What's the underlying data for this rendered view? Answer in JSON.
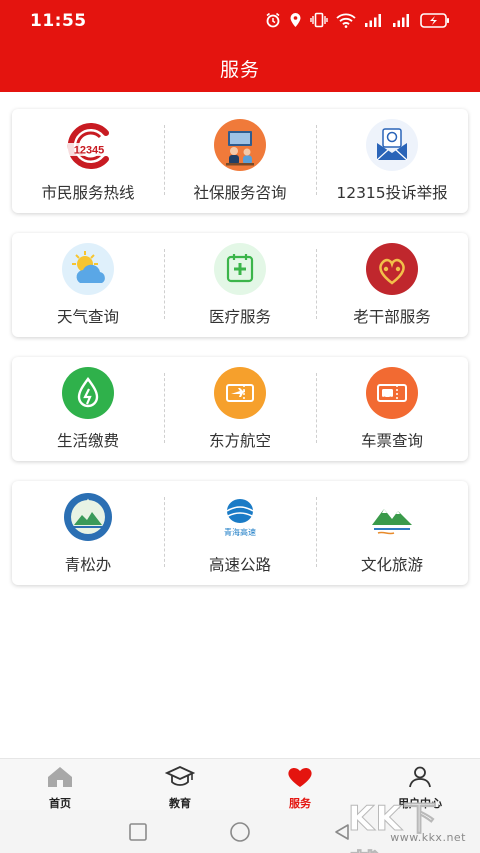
{
  "status_bar": {
    "time": "11:55",
    "icons": [
      "alarm-icon",
      "location-icon",
      "vibrate-icon",
      "wifi-icon",
      "signal-icon",
      "signal-icon",
      "battery-charging-icon"
    ]
  },
  "header": {
    "title": "服务"
  },
  "colors": {
    "primary": "#e4140f",
    "text": "#333333"
  },
  "services": [
    [
      {
        "label": "市民服务热线",
        "icon": "hotline-12345-icon",
        "icon_text": "12345"
      },
      {
        "label": "社保服务咨询",
        "icon": "social-security-icon"
      },
      {
        "label": "12315投诉举报",
        "icon": "complaint-mail-icon"
      }
    ],
    [
      {
        "label": "天气查询",
        "icon": "weather-icon"
      },
      {
        "label": "医疗服务",
        "icon": "medical-icon"
      },
      {
        "label": "老干部服务",
        "icon": "veteran-cadre-icon"
      }
    ],
    [
      {
        "label": "生活缴费",
        "icon": "utility-payment-icon"
      },
      {
        "label": "东方航空",
        "icon": "airline-ticket-icon"
      },
      {
        "label": "车票查询",
        "icon": "bus-ticket-icon"
      }
    ],
    [
      {
        "label": "青松办",
        "icon": "qingsong-logo-icon"
      },
      {
        "label": "高速公路",
        "icon": "highway-logo-icon",
        "icon_text": "青海高速"
      },
      {
        "label": "文化旅游",
        "icon": "culture-tourism-logo-icon"
      }
    ]
  ],
  "tabs": [
    {
      "label": "首页",
      "icon": "home-icon",
      "active": false
    },
    {
      "label": "教育",
      "icon": "graduation-cap-icon",
      "active": false
    },
    {
      "label": "服务",
      "icon": "heart-icon",
      "active": true
    },
    {
      "label": "用户中心",
      "icon": "user-icon",
      "active": false
    }
  ],
  "nav": [
    "recent-apps-icon",
    "home-circle-icon",
    "back-triangle-icon"
  ],
  "watermark": {
    "big": "KK下载",
    "small": "www.kkx.net"
  }
}
